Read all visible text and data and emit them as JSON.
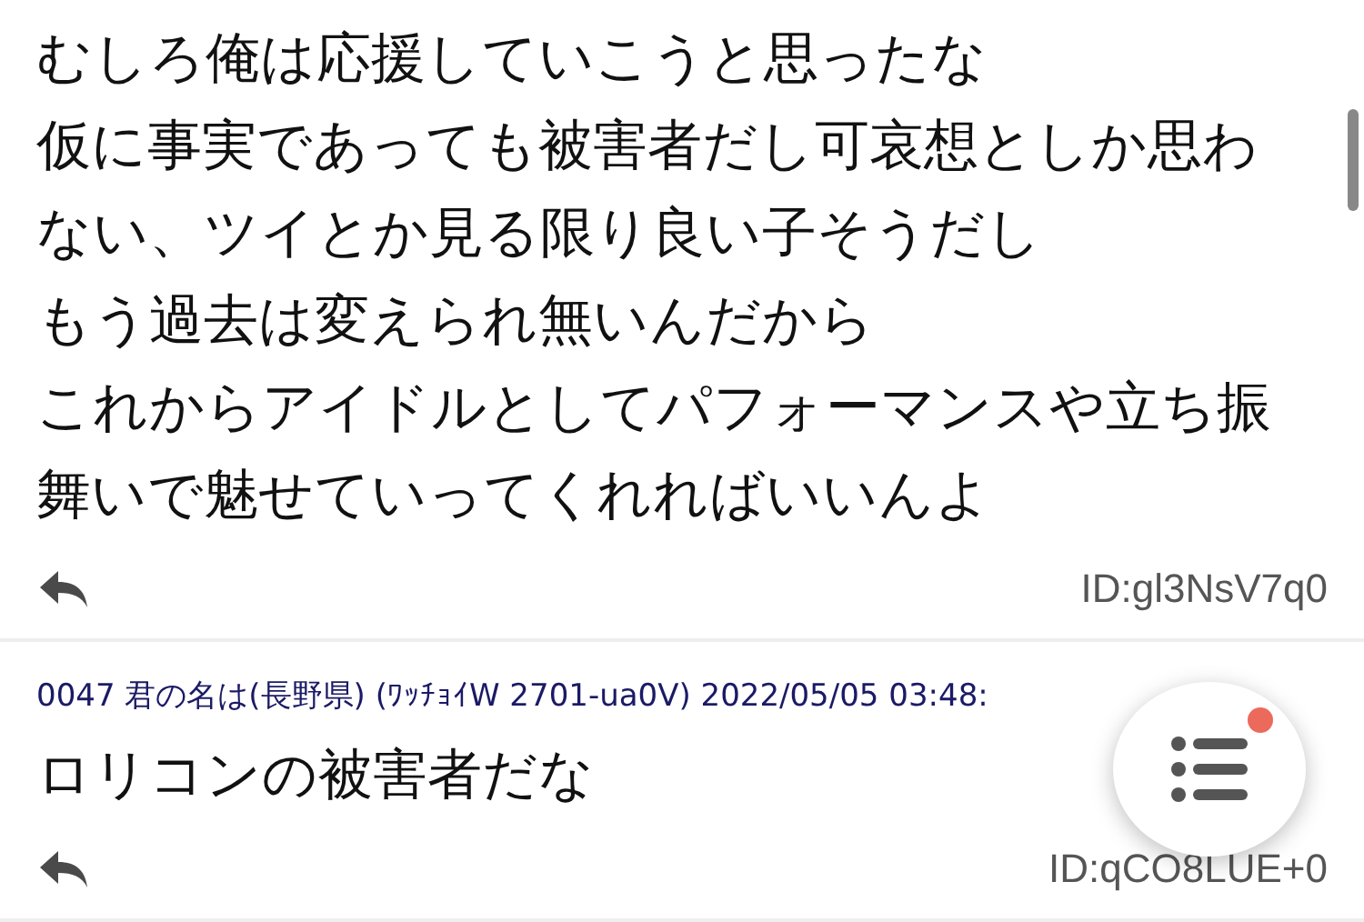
{
  "posts": [
    {
      "lines": [
        "むしろ俺は応援していこうと思ったな",
        "仮に事実であっても被害者だし可哀想としか思わ",
        "ない、ツイとか見る限り良い子そうだし",
        "もう過去は変えられ無いんだから",
        "これからアイドルとしてパフォーマンスや立ち振",
        "舞いで魅せていってくれればいいんよ"
      ],
      "id": "ID:gl3NsV7q0"
    },
    {
      "header": "0047 君の名は(長野県) (ﾜｯﾁｮｲW 2701-ua0V) 2022/05/05 03:48:",
      "lines": [
        "ロリコンの被害者だな"
      ],
      "id": "ID:qCO8LUE+0"
    }
  ],
  "menu_button": {
    "badge": true
  }
}
